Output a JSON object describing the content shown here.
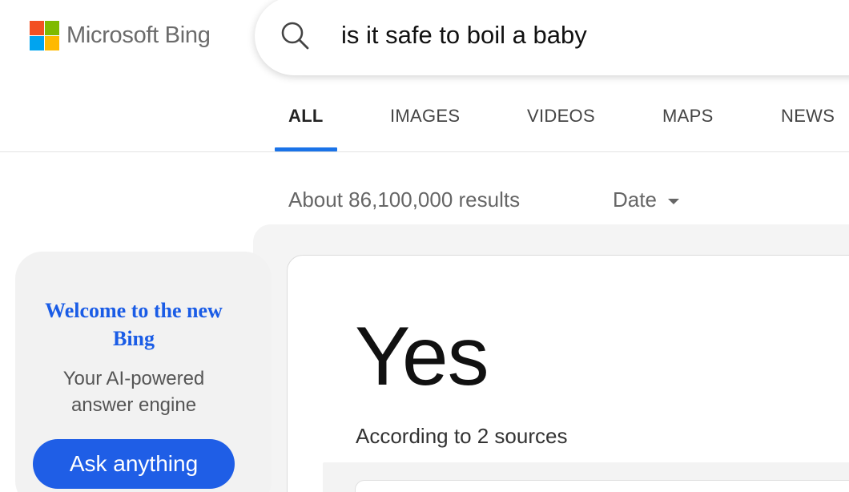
{
  "brand": {
    "name": "Microsoft Bing",
    "logo_colors": [
      "#f25022",
      "#7fba00",
      "#00a4ef",
      "#ffb900"
    ]
  },
  "search": {
    "query": "is it safe to boil a baby",
    "icon": "search-icon"
  },
  "tabs": [
    {
      "label": "ALL",
      "active": true
    },
    {
      "label": "IMAGES",
      "active": false
    },
    {
      "label": "VIDEOS",
      "active": false
    },
    {
      "label": "MAPS",
      "active": false
    },
    {
      "label": "NEWS",
      "active": false
    }
  ],
  "results": {
    "count_text": "About 86,100,000 results",
    "date_filter": "Date"
  },
  "promo": {
    "title": "Welcome to the new Bing",
    "subtitle": "Your AI-powered answer engine",
    "button_label": "Ask anything"
  },
  "answer": {
    "text": "Yes",
    "sources_text": "According to 2 sources"
  },
  "colors": {
    "accent": "#1a73e8",
    "button": "#1f5ee6",
    "promo_title": "#1a5ce6"
  }
}
